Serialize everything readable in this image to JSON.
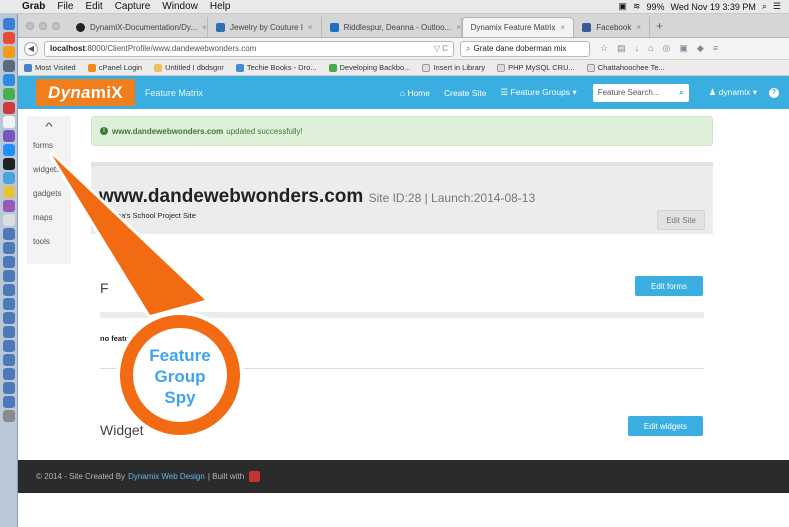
{
  "os_menubar": {
    "app_name": "Grab",
    "menus": [
      "File",
      "Edit",
      "Capture",
      "Window",
      "Help"
    ],
    "battery": "99%",
    "datetime": "Wed Nov 19  3:39 PM"
  },
  "browser": {
    "tabs": [
      {
        "label": "DynamiX-Documentation/Dy...",
        "active": false
      },
      {
        "label": "Jewelry by Couture I",
        "active": false
      },
      {
        "label": "Riddlespur, Deanna - Outloo...",
        "active": false
      },
      {
        "label": "Dynamix Feature Matrix",
        "active": true
      },
      {
        "label": "Facebook",
        "active": false
      }
    ],
    "url_prefix": "localhost",
    "url_rest": ":8000/ClientProfile/www.dandewebwonders.com",
    "search_value": "Grate dane doberman mix",
    "bookmarks": [
      "Most Visited",
      "cPanel Login",
      "Untitled I dbdsgnr",
      "Techie Books - Dro...",
      "Developing Backbo...",
      "Insert in Library",
      "PHP MySQL CRU...",
      "Chattahoochee Te..."
    ]
  },
  "app": {
    "logo_text_a": "Dyna",
    "logo_text_b": "miX",
    "subtitle": "Feature Matrix",
    "nav": {
      "home": "Home",
      "create_site": "Create Site",
      "feature_groups": "Feature Groups",
      "search_placeholder": "Feature Search...",
      "user": "dynamix"
    },
    "sidebar": [
      "forms",
      "widgets",
      "gadgets",
      "maps",
      "tools"
    ],
    "alert": {
      "domain": "www.dandewebwonders.com",
      "message": "updated successfully!"
    },
    "site": {
      "domain": "www.dandewebwonders.com",
      "meta": "Site ID:28 | Launch:2014-08-13",
      "description": "Deanna's School Project Site",
      "edit_label": "Edit Site"
    },
    "sections": [
      {
        "title": "F",
        "button": "Edit forms",
        "empty_text": "no featu"
      },
      {
        "title": "Widget",
        "button": "Edit widgets"
      }
    ],
    "footer": {
      "prefix": "© 2014 - Site Created By",
      "link": "Dynamix Web Design",
      "suffix": "| Built with"
    }
  },
  "annotation": {
    "lines": [
      "Feature",
      "Group",
      "Spy"
    ],
    "color": "#f26a12",
    "text_color": "#3fa3ef"
  }
}
